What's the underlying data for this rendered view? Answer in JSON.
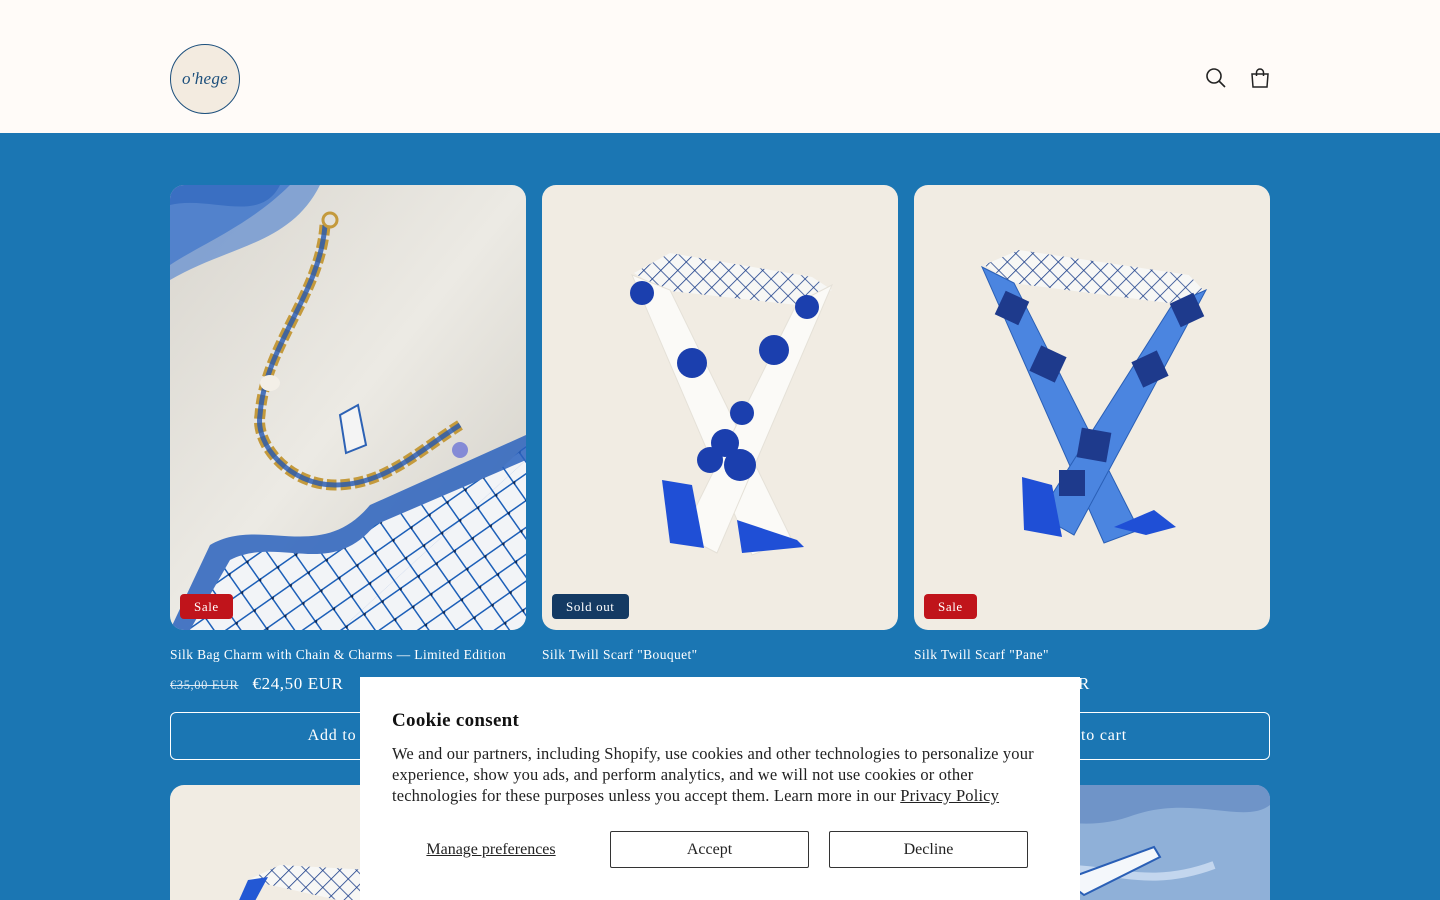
{
  "header": {
    "logo_text": "o'hege",
    "icons": [
      "search-icon",
      "cart-icon"
    ]
  },
  "products": [
    {
      "title": "Silk Bag Charm with Chain & Charms — Limited Edition",
      "badge": "Sale",
      "old_price": "€35,00 EUR",
      "price": "€24,50 EUR",
      "button": "Add to cart"
    },
    {
      "title": "Silk Twill Scarf \"Bouquet\"",
      "badge": "Sold out"
    },
    {
      "title": "Silk Twill Scarf \"Pane\"",
      "badge": "Sale",
      "old_price_fragment": "R",
      "button_fragment": "to cart"
    }
  ],
  "cookie": {
    "title": "Cookie consent",
    "body": "We and our partners, including Shopify, use cookies and other technologies to personalize your experience, show you ads, and perform analytics, and we will not use cookies or other technologies for these purposes unless you accept them. Learn more in our ",
    "link": "Privacy Policy",
    "manage": "Manage preferences",
    "accept": "Accept",
    "decline": "Decline"
  },
  "colors": {
    "page_bg": "#1b76b3",
    "header_bg": "#fffbf8",
    "sale_badge": "#c0141b",
    "soldout_badge": "#143a63"
  }
}
